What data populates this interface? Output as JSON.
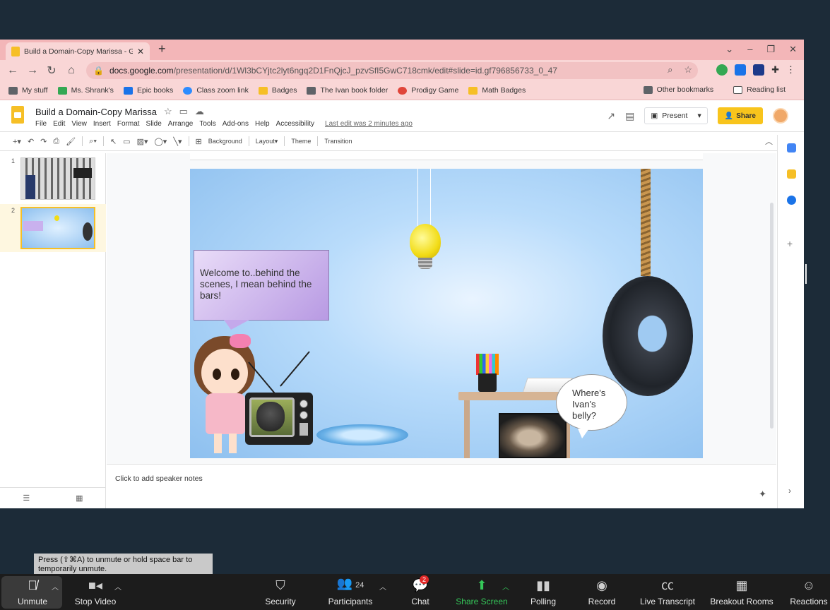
{
  "browser": {
    "tab_title": "Build a Domain-Copy Marissa - G",
    "url_domain": "docs.google.com",
    "url_path": "/presentation/d/1Wl3bCYjtc2lyt6ngq2D1FnQjcJ_pzvSfI5GwC718cmk/edit#slide=id.gf796856733_0_47",
    "bookmarks": [
      "My stuff",
      "Ms. Shrank's",
      "Epic books",
      "Class zoom link",
      "Badges",
      "The Ivan book folder",
      "Prodigy Game",
      "Math Badges"
    ],
    "other_bookmarks": "Other bookmarks",
    "reading_list": "Reading list"
  },
  "slides": {
    "title": "Build  a Domain-Copy Marissa",
    "menu": [
      "File",
      "Edit",
      "View",
      "Insert",
      "Format",
      "Slide",
      "Arrange",
      "Tools",
      "Add-ons",
      "Help",
      "Accessibility"
    ],
    "last_edit": "Last edit was 2 minutes ago",
    "present_label": "Present",
    "share_label": "Share",
    "toolbar": {
      "background": "Background",
      "layout": "Layout",
      "theme": "Theme",
      "transition": "Transition"
    },
    "thumb_numbers": [
      "1",
      "2"
    ],
    "notes_placeholder": "Click to add speaker notes",
    "slide_text": {
      "bubble1": "Welcome to..behind the scenes, I mean behind the bars!",
      "bubble2": "Where's Ivan's belly?"
    }
  },
  "zoom": {
    "tooltip": "Press  (⇧⌘A) to unmute or hold space bar to temporarily unmute.",
    "unmute": "Unmute",
    "stop_video": "Stop Video",
    "security": "Security",
    "participants": "Participants",
    "participant_count": "24",
    "chat": "Chat",
    "chat_badge": "2",
    "share_screen": "Share Screen",
    "polling": "Polling",
    "record": "Record",
    "live_transcript": "Live Transcript",
    "breakout_rooms": "Breakout Rooms",
    "reactions": "Reactions"
  },
  "colors": {
    "tabstrip": "#f3b6b8",
    "slides_accent": "#f6bf26",
    "zoom_bar": "#1c1c1c",
    "share_screen": "#35c759"
  }
}
